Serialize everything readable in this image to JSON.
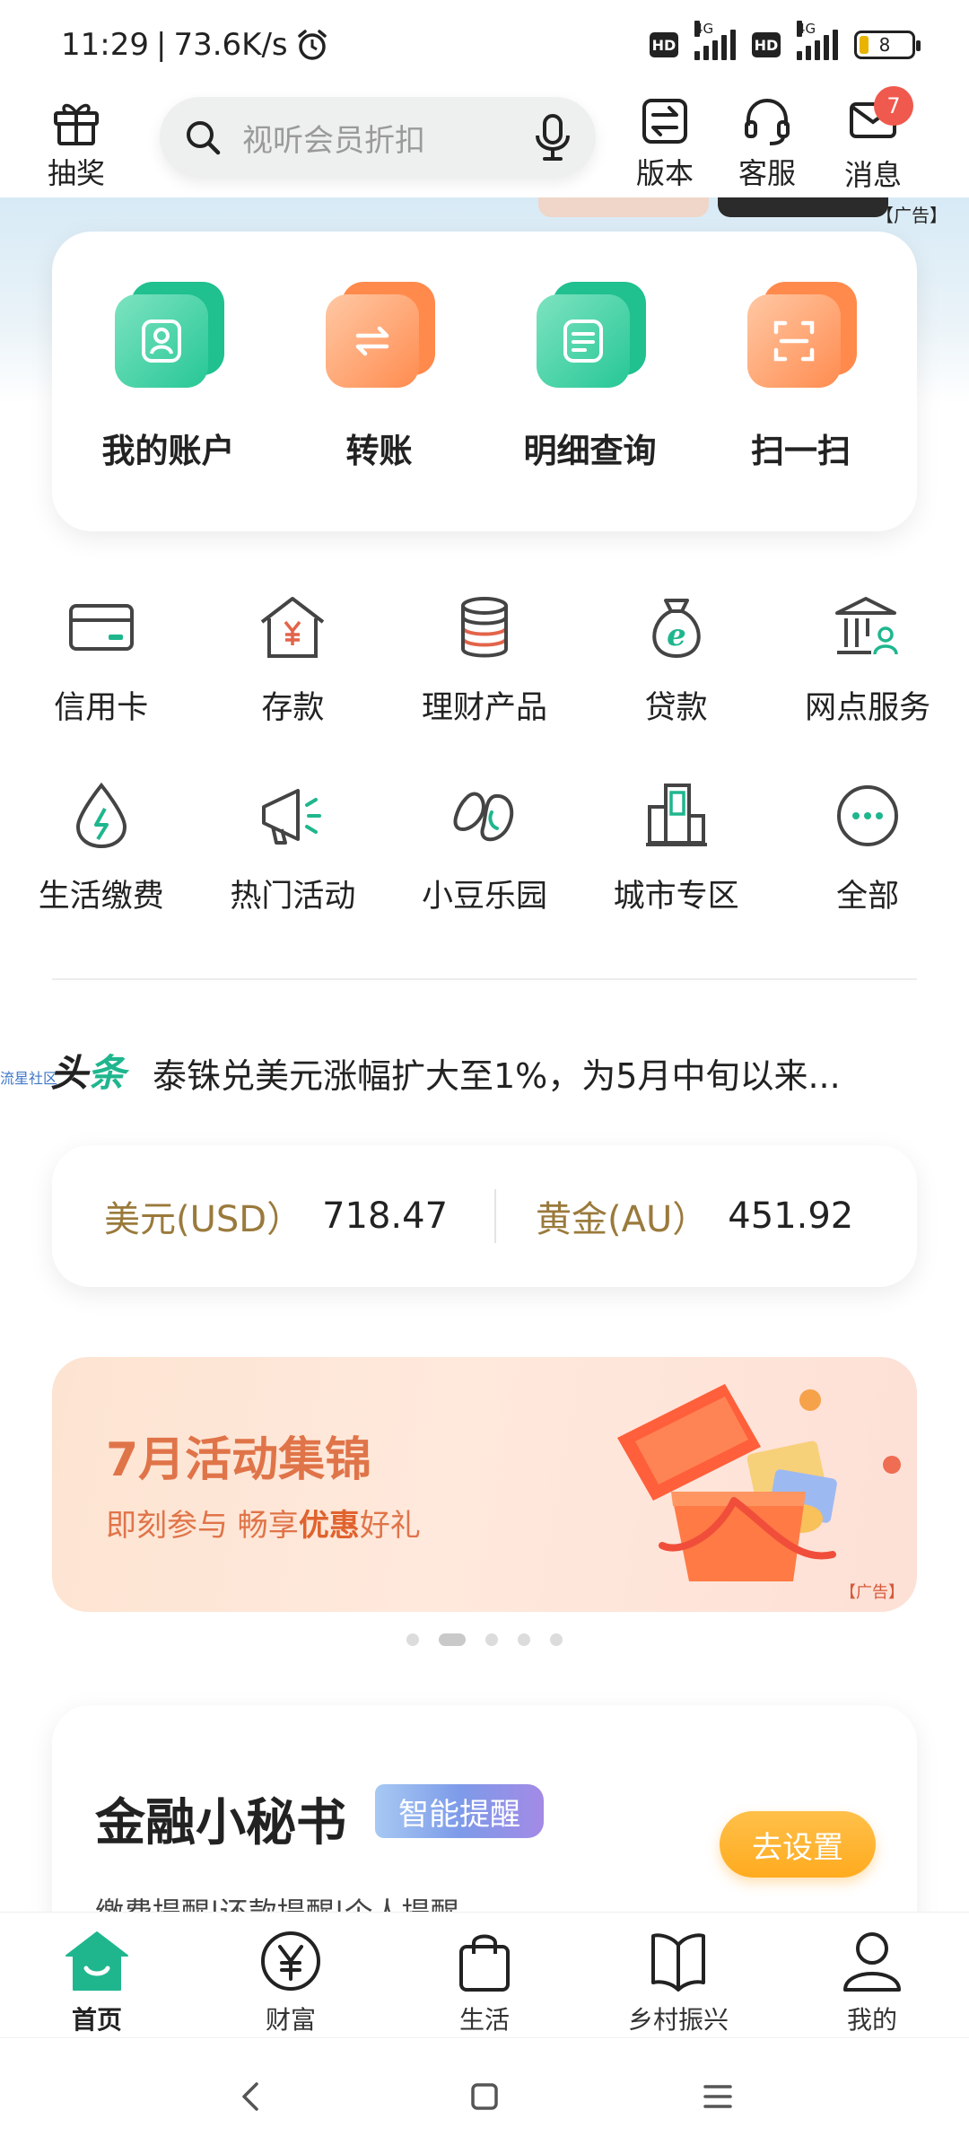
{
  "status_bar": {
    "time": "11:29",
    "speed": "73.6K/s",
    "network_1": "4G",
    "network_2": "4G",
    "hd": "HD",
    "battery": "8"
  },
  "header": {
    "lottery_label": "抽奖",
    "search_placeholder": "视听会员折扣",
    "version_label": "版本",
    "service_label": "客服",
    "message_label": "消息",
    "message_badge": "7"
  },
  "top_ad": {
    "tag": "【广告】"
  },
  "main_card": {
    "items": [
      {
        "label": "我的账户",
        "icon": "account-icon"
      },
      {
        "label": "转账",
        "icon": "transfer-icon"
      },
      {
        "label": "明细查询",
        "icon": "details-icon"
      },
      {
        "label": "扫一扫",
        "icon": "scan-icon"
      }
    ]
  },
  "services": {
    "row1": [
      {
        "label": "信用卡",
        "icon": "credit-card-icon"
      },
      {
        "label": "存款",
        "icon": "deposit-icon"
      },
      {
        "label": "理财产品",
        "icon": "wealth-icon"
      },
      {
        "label": "贷款",
        "icon": "loan-icon"
      },
      {
        "label": "网点服务",
        "icon": "branch-icon"
      }
    ],
    "row2": [
      {
        "label": "生活缴费",
        "icon": "bill-icon"
      },
      {
        "label": "热门活动",
        "icon": "megaphone-icon"
      },
      {
        "label": "小豆乐园",
        "icon": "bean-icon"
      },
      {
        "label": "城市专区",
        "icon": "city-icon"
      },
      {
        "label": "全部",
        "icon": "more-icon"
      }
    ]
  },
  "news": {
    "small": "流星社区",
    "logo_1": "头",
    "logo_2": "条",
    "text": "泰铢兑美元涨幅扩大至1%，为5月中旬以来..."
  },
  "rates": {
    "usd_label": "美元(USD）",
    "usd_value": "718.47",
    "gold_label": "黄金(AU）",
    "gold_value": "451.92"
  },
  "banner": {
    "title": "7月活动集锦",
    "sub_1": "即刻参与  畅享",
    "sub_bold": "优惠",
    "sub_2": "好礼",
    "ad_tag": "【广告】",
    "total_slides": 5,
    "active_slide": 2
  },
  "finance": {
    "title": "金融小秘书",
    "smart_tag": "智能提醒",
    "button": "去设置",
    "sub": "缴费提醒|还款提醒|个人提醒"
  },
  "bottom_nav": {
    "items": [
      {
        "label": "首页",
        "icon": "home-icon"
      },
      {
        "label": "财富",
        "icon": "yen-icon"
      },
      {
        "label": "生活",
        "icon": "bag-icon"
      },
      {
        "label": "乡村振兴",
        "icon": "book-icon"
      },
      {
        "label": "我的",
        "icon": "person-icon"
      }
    ]
  },
  "colors": {
    "accent_green": "#1fb68e",
    "accent_orange": "#ff8a4c",
    "badge_red": "#f0594d",
    "gold_text": "#9a7a3c"
  }
}
